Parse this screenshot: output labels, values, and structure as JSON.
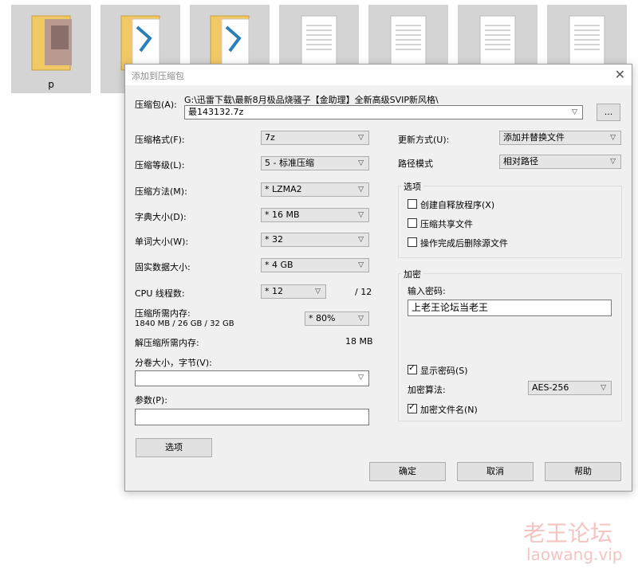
{
  "desktop": {
    "tiles": [
      {
        "label": "p",
        "icon": "photo-folder-icon"
      },
      {
        "label": "",
        "icon": "folder-icon"
      },
      {
        "label": "",
        "icon": "folder-icon"
      },
      {
        "label": "",
        "icon": "document-icon"
      },
      {
        "label": "",
        "icon": "document-icon"
      },
      {
        "label": "",
        "icon": "document-icon"
      },
      {
        "label": "",
        "icon": "document-icon"
      }
    ]
  },
  "dialog": {
    "title": "添加到压缩包",
    "close": "✕",
    "archive": {
      "label": "压缩包(A):",
      "path": "G:\\迅雷下载\\最新8月极品烧骚子【金助理】全新高级SVIP新风格\\",
      "filename": "最143132.7z",
      "browse": "..."
    },
    "left": {
      "format_label": "压缩格式(F):",
      "format_value": "7z",
      "level_label": "压缩等级(L):",
      "level_value": "5 - 标准压缩",
      "method_label": "压缩方法(M):",
      "method_value": "* LZMA2",
      "dict_label": "字典大小(D):",
      "dict_value": "* 16 MB",
      "word_label": "单词大小(W):",
      "word_value": "* 32",
      "solid_label": "固实数据大小:",
      "solid_value": "* 4 GB",
      "cpu_label": "CPU 线程数:",
      "cpu_value": "* 12",
      "cpu_max": "/ 12",
      "mem_label": "压缩所需内存:",
      "mem_detail": "1840 MB / 26 GB / 32 GB",
      "mem_value": "* 80%",
      "decomp_label": "解压缩所需内存:",
      "decomp_value": "18 MB",
      "volume_label": "分卷大小，字节(V):",
      "volume_value": "",
      "params_label": "参数(P):",
      "params_value": "",
      "options_button": "选项"
    },
    "right": {
      "update_label": "更新方式(U):",
      "update_value": "添加并替换文件",
      "path_label": "路径模式",
      "path_value": "相对路径",
      "options_group": "选项",
      "opt_sfx": "创建自释放程序(X)",
      "opt_shared": "压缩共享文件",
      "opt_delete": "操作完成后删除源文件",
      "encrypt_group": "加密",
      "password_label": "输入密码:",
      "password_value": "上老王论坛当老王",
      "show_password": "显示密码(S)",
      "algo_label": "加密算法:",
      "algo_value": "AES-256",
      "encrypt_names": "加密文件名(N)",
      "check_mark": "✓"
    },
    "buttons": {
      "ok": "确定",
      "cancel": "取消",
      "help": "帮助"
    }
  },
  "watermark": {
    "cn": "老王论坛",
    "url": "laowang.vip"
  }
}
